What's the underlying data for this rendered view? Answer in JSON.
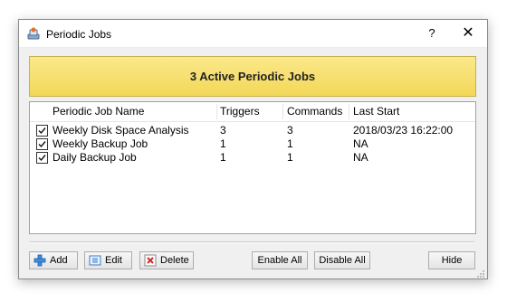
{
  "window": {
    "title": "Periodic Jobs",
    "help_label": "?",
    "close_label": "✕"
  },
  "banner": {
    "text": "3 Active Periodic Jobs"
  },
  "table": {
    "columns": [
      "Periodic Job Name",
      "Triggers",
      "Commands",
      "Last Start"
    ],
    "rows": [
      {
        "checked": true,
        "name": "Weekly Disk Space Analysis",
        "triggers": "3",
        "commands": "3",
        "last_start": "2018/03/23 16:22:00"
      },
      {
        "checked": true,
        "name": "Weekly Backup Job",
        "triggers": "1",
        "commands": "1",
        "last_start": "NA"
      },
      {
        "checked": true,
        "name": "Daily Backup Job",
        "triggers": "1",
        "commands": "1",
        "last_start": "NA"
      }
    ]
  },
  "buttons": {
    "add": "Add",
    "edit": "Edit",
    "delete": "Delete",
    "enable_all": "Enable All",
    "disable_all": "Disable All",
    "hide": "Hide"
  },
  "colors": {
    "banner_background": "#f5de6a",
    "dialog_background": "#f0f0f0"
  }
}
